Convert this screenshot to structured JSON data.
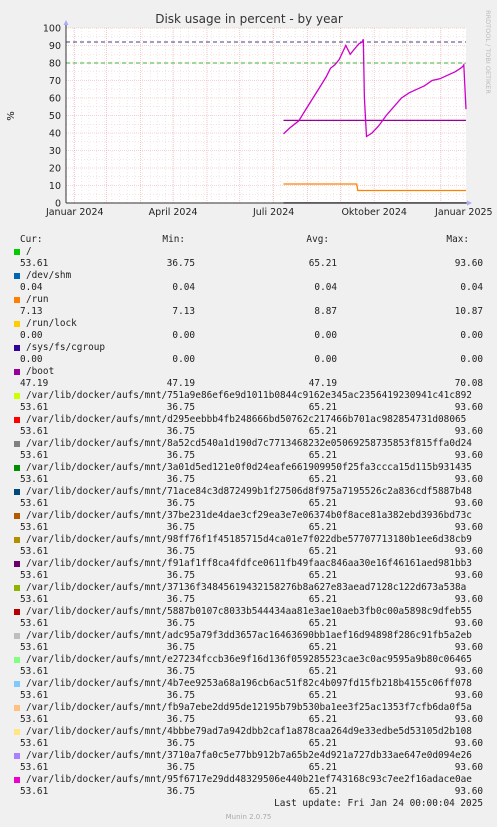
{
  "chart_data": {
    "type": "line",
    "title": "Disk usage in percent - by year",
    "ylabel": "%",
    "watermark": "RRDTOOL / TOBI OETIKER",
    "ylim": [
      0,
      100
    ],
    "yticks": [
      0,
      10,
      20,
      30,
      40,
      50,
      60,
      70,
      80,
      90,
      100
    ],
    "xticks": [
      "Januar 2024",
      "April 2024",
      "Juli 2024",
      "Oktober 2024",
      "Januar 2025"
    ],
    "xrange": [
      "2024-01-24",
      "2025-01-24"
    ],
    "warning_line": 80,
    "critical_line": 92,
    "grid": true,
    "series": [
      {
        "name": "/",
        "color": "#00cc00",
        "x": [],
        "y": []
      },
      {
        "name": "/dev/shm",
        "color": "#0066b3",
        "x": [
          "2024-08-10",
          "2025-01-24"
        ],
        "y": [
          0.04,
          0.04
        ]
      },
      {
        "name": "/run",
        "color": "#ff8000",
        "x": [
          "2024-08-10",
          "2024-10-16",
          "2024-10-17",
          "2025-01-24"
        ],
        "y": [
          10.87,
          10.87,
          7.13,
          7.13
        ]
      },
      {
        "name": "/run/lock",
        "color": "#ffcc00",
        "x": [
          "2024-08-10",
          "2025-01-24"
        ],
        "y": [
          0.0,
          0.0
        ]
      },
      {
        "name": "/sys/fs/cgroup",
        "color": "#330099",
        "x": [
          "2024-08-10",
          "2025-01-24"
        ],
        "y": [
          0.0,
          0.0
        ]
      },
      {
        "name": "/boot",
        "color": "#990099",
        "x": [
          "2024-08-10",
          "2025-01-24"
        ],
        "y": [
          47.19,
          47.19
        ]
      },
      {
        "name": "/var/lib/docker/aufs/mnt/95f6717e29dd48329506e440b21ef743168c93c7ee2f16adace0ae",
        "color": "#cc00cc",
        "x": [
          "2024-08-10",
          "2024-08-16",
          "2024-08-24",
          "2024-08-31",
          "2024-09-06",
          "2024-09-12",
          "2024-09-18",
          "2024-09-22",
          "2024-09-26",
          "2024-09-30",
          "2024-10-03",
          "2024-10-06",
          "2024-10-10",
          "2024-10-14",
          "2024-10-18",
          "2024-10-21",
          "2024-10-22",
          "2024-10-23",
          "2024-10-25",
          "2024-10-30",
          "2024-11-05",
          "2024-11-12",
          "2024-11-19",
          "2024-11-26",
          "2024-12-03",
          "2024-12-10",
          "2024-12-17",
          "2024-12-24",
          "2024-12-31",
          "2025-01-07",
          "2025-01-14",
          "2025-01-19",
          "2025-01-21",
          "2025-01-22",
          "2025-01-24"
        ],
        "y": [
          39.5,
          43,
          47,
          54,
          60,
          66,
          72,
          77,
          79,
          82,
          86,
          90,
          85,
          88,
          91,
          92,
          93.6,
          60,
          38,
          40,
          44,
          50,
          55,
          60,
          63,
          65,
          67,
          70,
          71,
          73,
          75,
          77,
          78,
          79,
          53.61
        ]
      }
    ]
  },
  "legend": {
    "headers": {
      "cur": "Cur:",
      "min": "Min:",
      "avg": "Avg:",
      "max": "Max:"
    },
    "rows": [
      {
        "name": "/",
        "color": "#00cc00",
        "cur": "53.61",
        "min": "36.75",
        "avg": "65.21",
        "max": "93.60"
      },
      {
        "name": "/dev/shm",
        "color": "#0066b3",
        "cur": "0.04",
        "min": "0.04",
        "avg": "0.04",
        "max": "0.04"
      },
      {
        "name": "/run",
        "color": "#ff8000",
        "cur": "7.13",
        "min": "7.13",
        "avg": "8.87",
        "max": "10.87"
      },
      {
        "name": "/run/lock",
        "color": "#ffcc00",
        "cur": "0.00",
        "min": "0.00",
        "avg": "0.00",
        "max": "0.00"
      },
      {
        "name": "/sys/fs/cgroup",
        "color": "#330099",
        "cur": "0.00",
        "min": "0.00",
        "avg": "0.00",
        "max": "0.00"
      },
      {
        "name": "/boot",
        "color": "#990099",
        "cur": "47.19",
        "min": "47.19",
        "avg": "47.19",
        "max": "70.08"
      },
      {
        "name": "/var/lib/docker/aufs/mnt/751a9e86ef6e9d1011b0844c9162e345ac2356419230941c41c892",
        "color": "#ccff00",
        "cur": "53.61",
        "min": "36.75",
        "avg": "65.21",
        "max": "93.60"
      },
      {
        "name": "/var/lib/docker/aufs/mnt/d295eebbb4fb248666bd50762c217466b701ac982854731d08065",
        "color": "#ff0000",
        "cur": "53.61",
        "min": "36.75",
        "avg": "65.21",
        "max": "93.60"
      },
      {
        "name": "/var/lib/docker/aufs/mnt/8a52cd540a1d190d7c7713468232e05069258735853f815ffa0d24",
        "color": "#808080",
        "cur": "53.61",
        "min": "36.75",
        "avg": "65.21",
        "max": "93.60"
      },
      {
        "name": "/var/lib/docker/aufs/mnt/3a01d5ed121e0f0d24eafe661909950f25fa3ccca15d115b931435",
        "color": "#008f00",
        "cur": "53.61",
        "min": "36.75",
        "avg": "65.21",
        "max": "93.60"
      },
      {
        "name": "/var/lib/docker/aufs/mnt/71ace84c3d872499b1f27506d8f975a7195526c2a836cdf5887b48",
        "color": "#00487d",
        "cur": "53.61",
        "min": "36.75",
        "avg": "65.21",
        "max": "93.60"
      },
      {
        "name": "/var/lib/docker/aufs/mnt/37be231de4dae3cf29ea3e7e06374b0f8ace81a382ebd3936bd73c",
        "color": "#b35a00",
        "cur": "53.61",
        "min": "36.75",
        "avg": "65.21",
        "max": "93.60"
      },
      {
        "name": "/var/lib/docker/aufs/mnt/98ff76f1f45185715d4ca01e7f022dbe57707713180b1ee6d38cb9",
        "color": "#b38f00",
        "cur": "53.61",
        "min": "36.75",
        "avg": "65.21",
        "max": "93.60"
      },
      {
        "name": "/var/lib/docker/aufs/mnt/f91af1ff8ca4fdfce0611fb49faac846aa30e16f46161aed981bb3",
        "color": "#6b006b",
        "cur": "53.61",
        "min": "36.75",
        "avg": "65.21",
        "max": "93.60"
      },
      {
        "name": "/var/lib/docker/aufs/mnt/37136f34845619432158276b8a627e83aead7128c122d673a538a",
        "color": "#8fb300",
        "cur": "53.61",
        "min": "36.75",
        "avg": "65.21",
        "max": "93.60"
      },
      {
        "name": "/var/lib/docker/aufs/mnt/5887b0107c8033b544434aa81e3ae10aeb3fb0c00a5898c9dfeb55",
        "color": "#b30000",
        "cur": "53.61",
        "min": "36.75",
        "avg": "65.21",
        "max": "93.60"
      },
      {
        "name": "/var/lib/docker/aufs/mnt/adc95a79f3dd3657ac16463690bb1aef16d94898f286c91fb5a2eb",
        "color": "#bebebe",
        "cur": "53.61",
        "min": "36.75",
        "avg": "65.21",
        "max": "93.60"
      },
      {
        "name": "/var/lib/docker/aufs/mnt/e27234fccb36e9f16d136f059285523cae3c0ac9595a9b80c06465",
        "color": "#80ff80",
        "cur": "53.61",
        "min": "36.75",
        "avg": "65.21",
        "max": "93.60"
      },
      {
        "name": "/var/lib/docker/aufs/mnt/4b7ee9253a68a196cb6ac51f82c4b097fd15fb218b4155c06ff078",
        "color": "#80c9ff",
        "cur": "53.61",
        "min": "36.75",
        "avg": "65.21",
        "max": "93.60"
      },
      {
        "name": "/var/lib/docker/aufs/mnt/fb9a7ebe2dd95de12195b79b530ba1ee3f25ac1353f7cfb6da0f5a",
        "color": "#ffc080",
        "cur": "53.61",
        "min": "36.75",
        "avg": "65.21",
        "max": "93.60"
      },
      {
        "name": "/var/lib/docker/aufs/mnt/4bbbe79ad7a942dbb2caf1a878caa264d9e33edbe5d53105d2b108",
        "color": "#ffe680",
        "cur": "53.61",
        "min": "36.75",
        "avg": "65.21",
        "max": "93.60"
      },
      {
        "name": "/var/lib/docker/aufs/mnt/3710a7fa0c5e77bb912b7a65b2e4d921a727db33ae647e0d094e26",
        "color": "#aa80ff",
        "cur": "53.61",
        "min": "36.75",
        "avg": "65.21",
        "max": "93.60"
      },
      {
        "name": "/var/lib/docker/aufs/mnt/95f6717e29dd48329506e440b21ef743168c93c7ee2f16adace0ae",
        "color": "#ee00cc",
        "cur": "53.61",
        "min": "36.75",
        "avg": "65.21",
        "max": "93.60"
      }
    ]
  },
  "footer": {
    "last_update": "Last update: Fri Jan 24 00:00:04 2025",
    "munin": "Munin 2.0.75"
  }
}
